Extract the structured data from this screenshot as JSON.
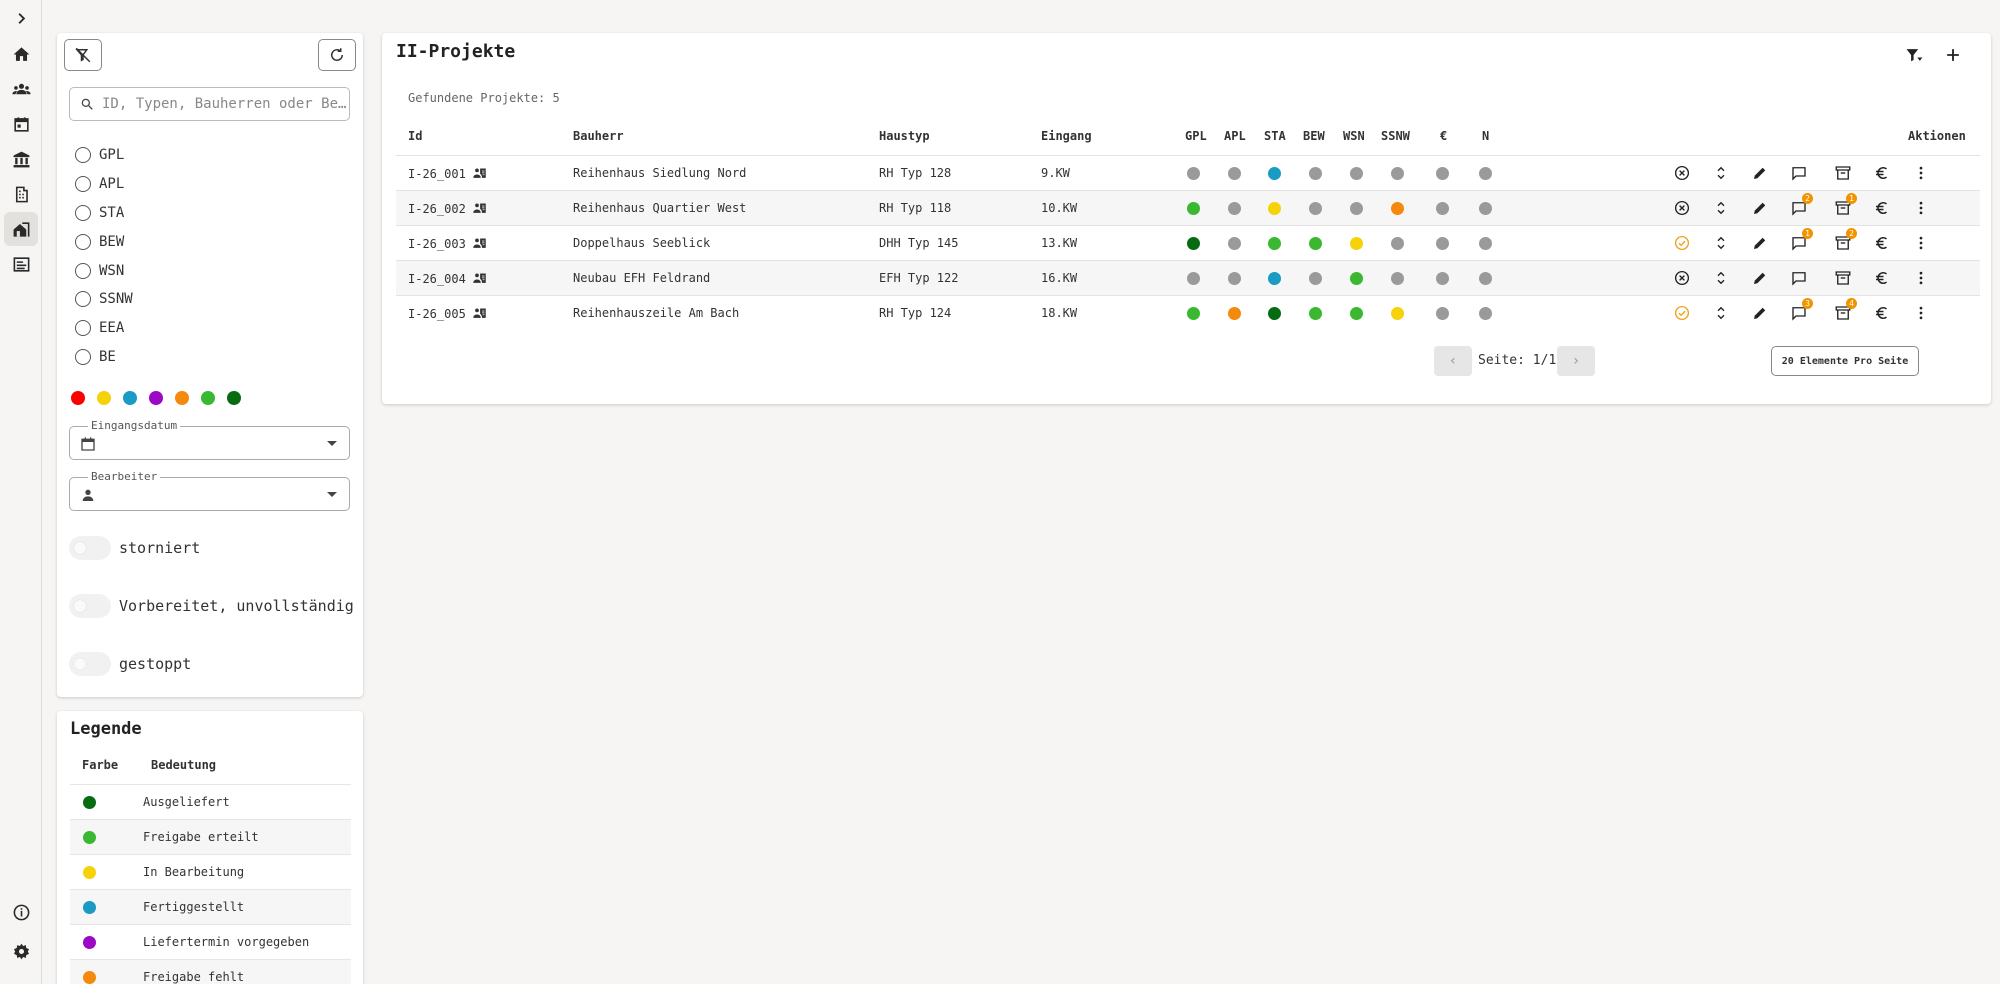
{
  "nav": {
    "items": [
      {
        "name": "expand-icon"
      },
      {
        "name": "home-icon"
      },
      {
        "name": "people-icon"
      },
      {
        "name": "calendar-icon"
      },
      {
        "name": "bank-icon"
      },
      {
        "name": "building-icon"
      },
      {
        "name": "projects-icon",
        "active": true
      },
      {
        "name": "document-icon"
      },
      {
        "name": "info-icon"
      },
      {
        "name": "settings-icon"
      }
    ]
  },
  "filter": {
    "search_placeholder": "ID, Typen, Bauherren oder Be…",
    "categories": [
      "GPL",
      "APL",
      "STA",
      "BEW",
      "WSN",
      "SSNW",
      "EEA",
      "BE"
    ],
    "colors": [
      "#ff0000",
      "#f5d20a",
      "#1a9bc4",
      "#9b08c6",
      "#f5890c",
      "#3ab832",
      "#076b12"
    ],
    "date_label": "Eingangsdatum",
    "editor_label": "Bearbeiter",
    "toggles": [
      "storniert",
      "Vorbereitet, unvollständig",
      "gestoppt"
    ]
  },
  "legend": {
    "title": "Legende",
    "col_color": "Farbe",
    "col_meaning": "Bedeutung",
    "rows": [
      {
        "color": "#076b12",
        "label": "Ausgeliefert"
      },
      {
        "color": "#3ab832",
        "label": "Freigabe erteilt"
      },
      {
        "color": "#f5d20a",
        "label": "In Bearbeitung"
      },
      {
        "color": "#1a9bc4",
        "label": "Fertiggestellt"
      },
      {
        "color": "#9b08c6",
        "label": "Liefertermin vorgegeben"
      },
      {
        "color": "#f5890c",
        "label": "Freigabe fehlt"
      }
    ]
  },
  "main": {
    "title": "II-Projekte",
    "found": "Gefundene Projekte: 5",
    "columns": {
      "id": "Id",
      "owner": "Bauherr",
      "type": "Haustyp",
      "entry": "Eingang",
      "status": [
        "GPL",
        "APL",
        "STA",
        "BEW",
        "WSN",
        "SSNW",
        "€",
        "N"
      ],
      "actions": "Aktionen"
    },
    "rows": [
      {
        "id": "I-26_001",
        "owner": "Reihenhaus Siedlung Nord",
        "type": "RH Typ 128",
        "entry": "9.KW",
        "status": [
          "#9a9a9a",
          "#9a9a9a",
          "#1a9bc4",
          "#9a9a9a",
          "#9a9a9a",
          "#9a9a9a",
          "#9a9a9a",
          "#9a9a9a"
        ],
        "state_icon": "cancel-circle-icon",
        "comments": "",
        "archive": ""
      },
      {
        "id": "I-26_002",
        "owner": "Reihenhaus Quartier West",
        "type": "RH Typ 118",
        "entry": "10.KW",
        "status": [
          "#3ab832",
          "#9a9a9a",
          "#f5d20a",
          "#9a9a9a",
          "#9a9a9a",
          "#f5890c",
          "#9a9a9a",
          "#9a9a9a"
        ],
        "state_icon": "cancel-circle-icon",
        "comments": "2",
        "archive": "1"
      },
      {
        "id": "I-26_003",
        "owner": "Doppelhaus Seeblick",
        "type": "DHH Typ 145",
        "entry": "13.KW",
        "status": [
          "#076b12",
          "#9a9a9a",
          "#3ab832",
          "#3ab832",
          "#f5d20a",
          "#9a9a9a",
          "#9a9a9a",
          "#9a9a9a"
        ],
        "state_icon": "check-circle-icon",
        "comments": "1",
        "archive": "2"
      },
      {
        "id": "I-26_004",
        "owner": "Neubau EFH Feldrand",
        "type": "EFH Typ 122",
        "entry": "16.KW",
        "status": [
          "#9a9a9a",
          "#9a9a9a",
          "#1a9bc4",
          "#9a9a9a",
          "#3ab832",
          "#9a9a9a",
          "#9a9a9a",
          "#9a9a9a"
        ],
        "state_icon": "cancel-circle-icon",
        "comments": "",
        "archive": ""
      },
      {
        "id": "I-26_005",
        "owner": "Reihenhauszeile Am Bach",
        "type": "RH Typ 124",
        "entry": "18.KW",
        "status": [
          "#3ab832",
          "#f5890c",
          "#076b12",
          "#3ab832",
          "#3ab832",
          "#f5d20a",
          "#9a9a9a",
          "#9a9a9a"
        ],
        "state_icon": "check-circle-icon",
        "comments": "3",
        "archive": "4"
      }
    ],
    "page_label": "Seite: 1/1",
    "per_page": "20 Elemente Pro Seite"
  }
}
